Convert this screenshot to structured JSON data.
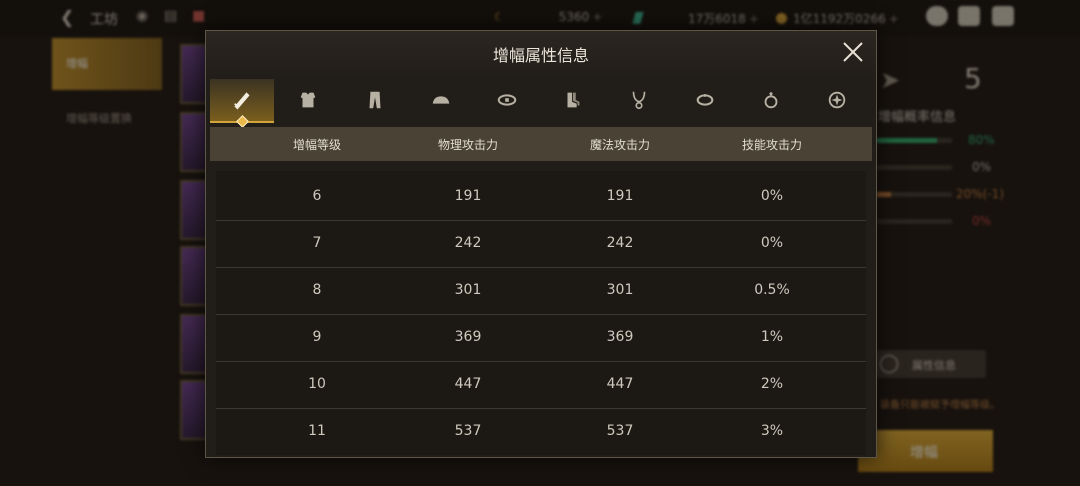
{
  "topbar": {
    "title": "工坊",
    "resources": [
      {
        "value": "5360",
        "plus": "+",
        "icon": "moon-coin-icon"
      },
      {
        "value": "17万6018",
        "plus": "+",
        "icon": "gem-icon"
      },
      {
        "value": "1亿1192万0266",
        "plus": "+",
        "icon": "gold-coin-icon"
      }
    ]
  },
  "leftnav": {
    "items": [
      {
        "label": "增幅",
        "active": true
      },
      {
        "label": "增幅等级置换",
        "active": false
      }
    ]
  },
  "rightpanel": {
    "target_level": "5",
    "label": "增幅概率信息",
    "rates": [
      {
        "value": "80%",
        "fill": 0.8,
        "color": "#2aa86a"
      },
      {
        "value": "0%",
        "fill": 0,
        "color": "#888888"
      },
      {
        "value": "20%(-1)",
        "fill": 0.2,
        "color": "#c07a3a"
      },
      {
        "value": "0%",
        "fill": 0,
        "color": "#c0403a"
      }
    ],
    "attr_button": "属性信息",
    "hint": "装备只能被赋予增幅等级。",
    "action_button": "增幅"
  },
  "modal": {
    "title": "增幅属性信息",
    "tabs": [
      {
        "icon": "sword-icon",
        "active": true
      },
      {
        "icon": "chest-armor-icon",
        "active": false
      },
      {
        "icon": "pants-icon",
        "active": false
      },
      {
        "icon": "shoulder-icon",
        "active": false
      },
      {
        "icon": "belt-icon",
        "active": false
      },
      {
        "icon": "boots-icon",
        "active": false
      },
      {
        "icon": "necklace-icon",
        "active": false
      },
      {
        "icon": "bracelet-icon",
        "active": false
      },
      {
        "icon": "ring-icon",
        "active": false
      },
      {
        "icon": "special-gear-icon",
        "active": false
      }
    ],
    "columns": [
      "增幅等级",
      "物理攻击力",
      "魔法攻击力",
      "技能攻击力"
    ],
    "rows": [
      [
        "6",
        "191",
        "191",
        "0%"
      ],
      [
        "7",
        "242",
        "242",
        "0%"
      ],
      [
        "8",
        "301",
        "301",
        "0.5%"
      ],
      [
        "9",
        "369",
        "369",
        "1%"
      ],
      [
        "10",
        "447",
        "447",
        "2%"
      ],
      [
        "11",
        "537",
        "537",
        "3%"
      ]
    ]
  }
}
